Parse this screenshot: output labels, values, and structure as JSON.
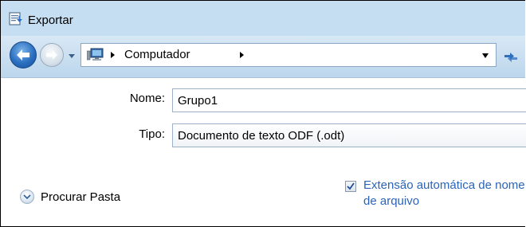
{
  "window": {
    "title": "Exportar"
  },
  "address_bar": {
    "location": "Computador"
  },
  "form": {
    "name_label": "Nome:",
    "name_value": "Grupo1",
    "type_label": "Tipo:",
    "type_value": "Documento de texto ODF (.odt)"
  },
  "browse_folders": {
    "label": "Procurar Pasta"
  },
  "auto_extension": {
    "label": "Extensão automática de nome de arquivo",
    "checked": true
  },
  "icons": {
    "app": "save-dialog-icon",
    "back": "back-arrow-icon",
    "forward": "forward-arrow-icon",
    "location": "computer-icon",
    "refresh": "refresh-icon",
    "expand": "chevron-down-icon"
  },
  "colors": {
    "titlebar": "#c6def1",
    "link_text": "#2b64b8",
    "back_button": "#2a6fc0"
  }
}
